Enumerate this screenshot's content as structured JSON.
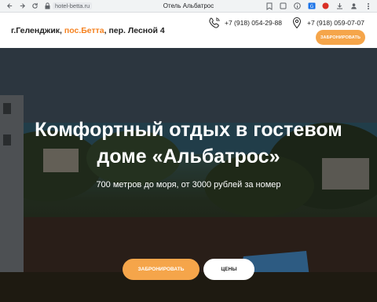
{
  "browser": {
    "url": "hotel-betta.ru",
    "tab_title": "Отель Альбатрос"
  },
  "header": {
    "address_prefix": "г.Геленджик, ",
    "address_accent": "пос.Бетта",
    "address_suffix": ", пер. Лесной 4",
    "phone1": "+7 (918) 054-29-88",
    "phone2": "+7 (918) 059-07-07",
    "book_label": "Забронировать"
  },
  "hero": {
    "title_line1": "Комфортный отдых в гостевом",
    "title_line2": "доме «Альбатрос»",
    "subtitle": "700 метров до моря, от 3000 рублей за номер",
    "book_label": "Забронировать",
    "prices_label": "Цены"
  },
  "colors": {
    "accent": "#f58220",
    "button": "#f5a54a"
  }
}
